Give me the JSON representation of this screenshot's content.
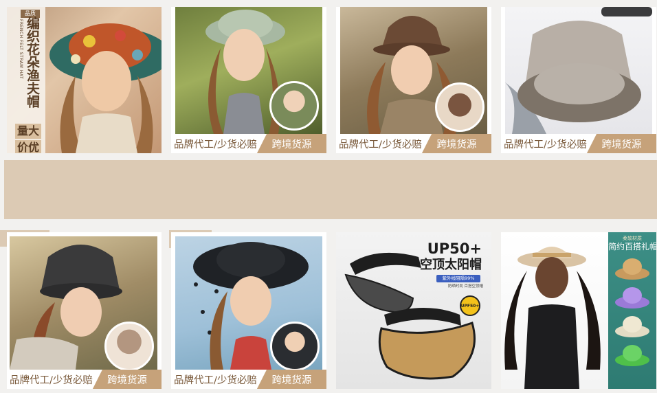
{
  "cards_row1": [
    {
      "vertical_title": "编织花朵渔夫帽",
      "vertical_subtitle": "FRENCH FELT STRAW HAT",
      "badge_lines": [
        "量大",
        "价优"
      ],
      "tiny_tag": "品质",
      "icon": "hat-model-photo"
    },
    {
      "bar_left": "品牌代工/少货必赔",
      "bar_right": "跨境货源",
      "icon": "hat-model-photo"
    },
    {
      "bar_left": "品牌代工/少货必赔",
      "bar_right": "跨境货源",
      "icon": "hat-model-photo"
    },
    {
      "bar_left": "品牌代工/少货必赔",
      "bar_right": "跨境货源",
      "icon": "hat-product-photo"
    }
  ],
  "cards_row2": [
    {
      "bar_left": "品牌代工/少货必赔",
      "bar_right": "跨境货源",
      "icon": "hat-model-photo"
    },
    {
      "bar_left": "品牌代工/少货必赔",
      "bar_right": "跨境货源",
      "icon": "hat-model-photo"
    },
    {
      "ad_title_1": "UP50+",
      "ad_title_2": "空顶太阳帽",
      "ad_pill": "紫外线阻隔99%",
      "ad_sub": "防晒时尚 百搭空顶帽",
      "ad_seal": "UPF50+",
      "icon": "visor-product-photo"
    },
    {
      "side_small": "柔软材质",
      "side_title": "简约百搭礼帽",
      "icon": "hat-model-photo"
    }
  ],
  "colors": {
    "accent_tan": "#c6a27a",
    "banner": "#dccab4",
    "text_brown": "#7a5a3b"
  }
}
